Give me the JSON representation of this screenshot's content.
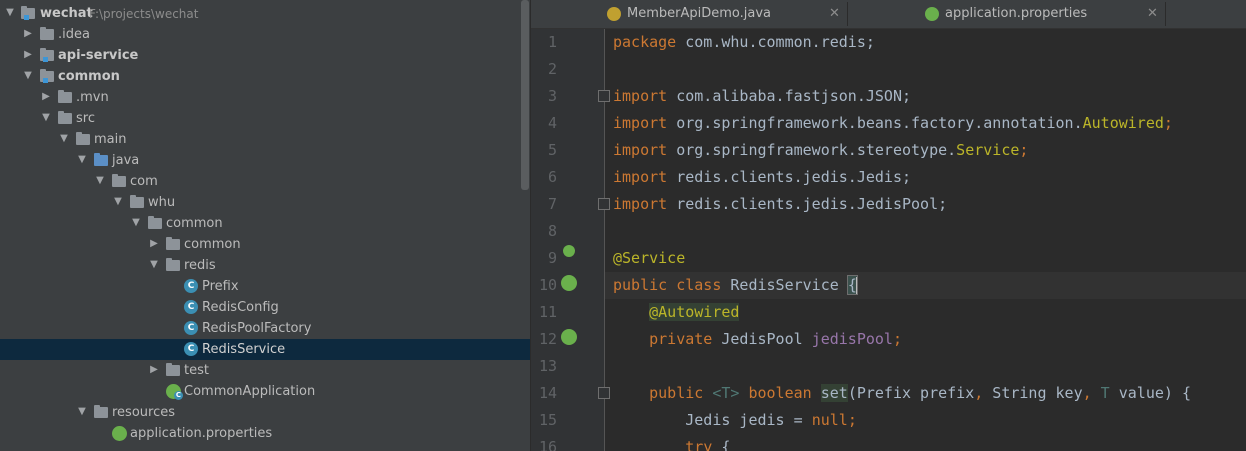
{
  "project_tree": {
    "root": {
      "label": "wechat",
      "path": "F:\\projects\\wechat"
    },
    "items": [
      {
        "label": ".idea"
      },
      {
        "label": "api-service"
      },
      {
        "label": "common"
      },
      {
        "label": ".mvn"
      },
      {
        "label": "src"
      },
      {
        "label": "main"
      },
      {
        "label": "java"
      },
      {
        "label": "com"
      },
      {
        "label": "whu"
      },
      {
        "label": "common"
      },
      {
        "label": "common"
      },
      {
        "label": "redis"
      },
      {
        "label": "Prefix"
      },
      {
        "label": "RedisConfig"
      },
      {
        "label": "RedisPoolFactory"
      },
      {
        "label": "RedisService"
      },
      {
        "label": "test"
      },
      {
        "label": "CommonApplication"
      },
      {
        "label": "resources"
      },
      {
        "label": "application.properties"
      }
    ]
  },
  "editor": {
    "tabs": [
      {
        "label": "MemberApiDemo.java",
        "close": "✕"
      },
      {
        "label": "application.properties",
        "close": "✕"
      }
    ],
    "line_numbers": [
      "1",
      "2",
      "3",
      "4",
      "5",
      "6",
      "7",
      "8",
      "9",
      "10",
      "11",
      "12",
      "13",
      "14",
      "15",
      "16"
    ],
    "code": {
      "l1": {
        "kw": "package",
        "rest": " com.whu.common.redis;"
      },
      "l3": {
        "kw": "import",
        "rest": " com.alibaba.fastjson.JSON;"
      },
      "l4": {
        "kw": "import",
        "rest": " org.springframework.beans.factory.annotation.",
        "ann": "Autowired",
        "end": ";"
      },
      "l5": {
        "kw": "import",
        "rest": " org.springframework.stereotype.",
        "ann": "Service",
        "end": ";"
      },
      "l6": {
        "kw": "import",
        "rest": " redis.clients.jedis.Jedis;"
      },
      "l7": {
        "kw": "import",
        "rest": " redis.clients.jedis.JedisPool;"
      },
      "l9": {
        "ann": "@Service"
      },
      "l10": {
        "kw": "public class",
        "name": " RedisService ",
        "brace": "{"
      },
      "l11": {
        "ann": "@Autowired"
      },
      "l12": {
        "kw": "private",
        "type": " JedisPool ",
        "field": "jedisPool",
        "end": ";"
      },
      "l14": {
        "kw1": "public ",
        "tparam": "<T>",
        "kw2": " boolean ",
        "method": "set",
        "params_a": "(Prefix prefix",
        "kw3": ",",
        "params_b": " String key",
        "kw4": ",",
        "tvar": " T",
        "params_c": " value) {"
      },
      "l15": {
        "type": "Jedis jedis = ",
        "kw": "null",
        "end": ";"
      },
      "l16": {
        "kw": "try",
        "rest": " {"
      }
    }
  },
  "colors": {
    "tree_bg": "#3c3f41",
    "editor_bg": "#2b2b2b",
    "keyword": "#cc7832",
    "annotation": "#bbb529",
    "field": "#9876aa",
    "text": "#a9b7c6",
    "selection": "#0d293e"
  }
}
